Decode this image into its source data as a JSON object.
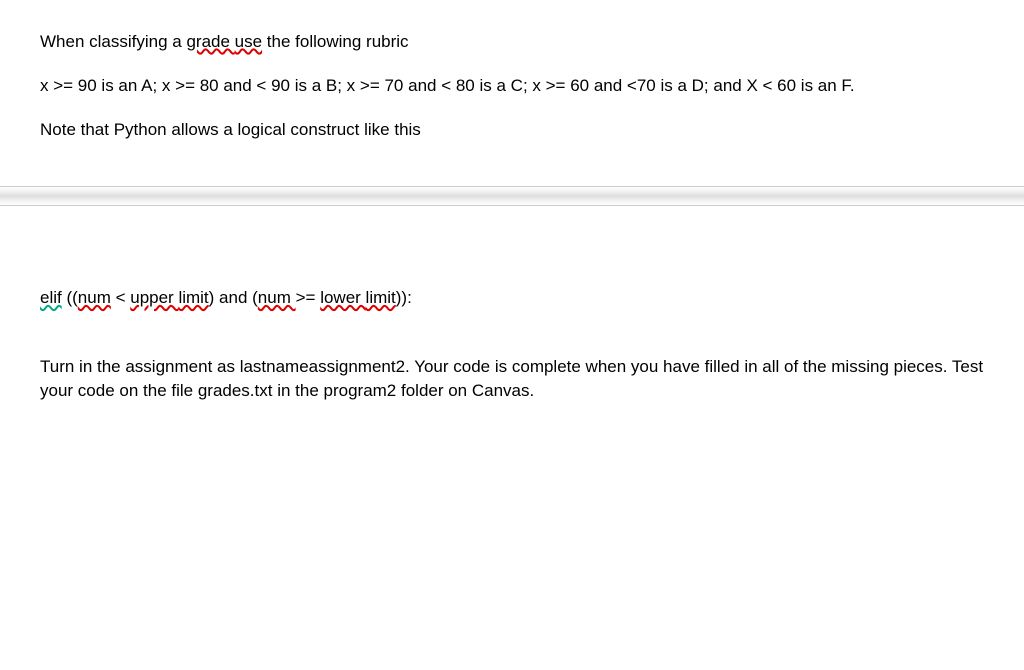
{
  "para1": {
    "part1": "When classifying a ",
    "spell1": "grade ",
    "spell2": "use",
    "part2": " the following rubric"
  },
  "para2": "x >= 90 is an A; x >= 80 and < 90 is a B; x >= 70 and < 80 is a C; x >= 60 and <70 is a D; and X < 60 is an F.",
  "para3": "Note that Python allows a logical construct like this",
  "para4": {
    "g1": "elif",
    "t1": " ((",
    "s1": "num",
    "t2": " < ",
    "s2": "upper ",
    "s3": "limit",
    "t3": ") and (",
    "s4": "num ",
    "t4": ">= ",
    "s5": "lower ",
    "s6": "limit",
    "t5": ")):"
  },
  "para5": "Turn in the assignment as lastnameassignment2. Your code is complete when you have filled in all of the missing pieces. Test your code on the file grades.txt in the program2 folder on Canvas."
}
